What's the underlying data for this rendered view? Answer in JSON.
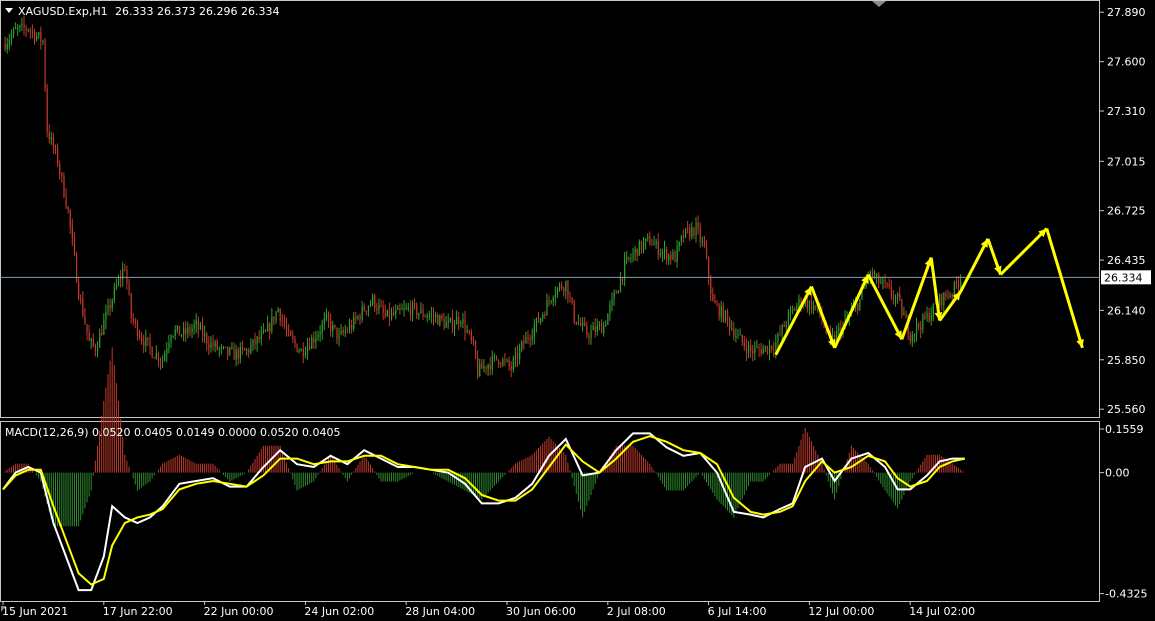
{
  "header": {
    "symbol": "XAGUSD.Exp,H1",
    "ohlc": "26.333 26.373 26.296 26.334",
    "macd_label": "MACD(12,26,9) 0.0520 0.0405 0.0149 0.0000 0.0520 0.0405"
  },
  "colors": {
    "background": "#000000",
    "bull": "#2ea02e",
    "bear": "#c0392b",
    "macd_line": "#ffffff",
    "signal_line": "#ffff00",
    "hist_pos": "#c0392b",
    "hist_neg": "#2e8b2e",
    "arrow": "#ffff00",
    "price_line": "#7f9bb3",
    "frame": "#c8c8c8"
  },
  "chart_data": [
    {
      "type": "candlestick",
      "ylim": [
        25.52,
        27.95
      ],
      "y_ticks": [
        "27.890",
        "27.600",
        "27.310",
        "27.015",
        "26.725",
        "26.435",
        "26.140",
        "25.850",
        "25.560"
      ],
      "y_tick_values": [
        27.89,
        27.6,
        27.31,
        27.015,
        26.725,
        26.435,
        26.14,
        25.85,
        25.56
      ],
      "current_price": 26.334,
      "current_price_label": "26.334",
      "x_ticks": [
        "15 Jun 2021",
        "17 Jun 22:00",
        "22 Jun 00:00",
        "24 Jun 02:00",
        "28 Jun 04:00",
        "30 Jun 06:00",
        "2 Jul 08:00",
        "6 Jul 14:00",
        "12 Jul 00:00",
        "14 Jul 02:00"
      ],
      "x_tick_bars": [
        0,
        48,
        96,
        144,
        192,
        240,
        288,
        336,
        384,
        432
      ],
      "close_path": [
        [
          0,
          27.7
        ],
        [
          6,
          27.78
        ],
        [
          12,
          27.8
        ],
        [
          16,
          27.75
        ],
        [
          19,
          27.72
        ],
        [
          21,
          27.2
        ],
        [
          26,
          27.02
        ],
        [
          31,
          26.72
        ],
        [
          36,
          26.25
        ],
        [
          41,
          25.95
        ],
        [
          44,
          25.92
        ],
        [
          49,
          26.1
        ],
        [
          54,
          26.28
        ],
        [
          58,
          26.4
        ],
        [
          61,
          26.1
        ],
        [
          66,
          25.98
        ],
        [
          71,
          25.9
        ],
        [
          76,
          25.85
        ],
        [
          80,
          26.02
        ],
        [
          86,
          26.0
        ],
        [
          92,
          26.05
        ],
        [
          98,
          25.95
        ],
        [
          104,
          25.9
        ],
        [
          110,
          25.88
        ],
        [
          116,
          25.9
        ],
        [
          120,
          25.95
        ],
        [
          125,
          26.0
        ],
        [
          131,
          26.15
        ],
        [
          136,
          25.98
        ],
        [
          142,
          25.9
        ],
        [
          148,
          25.98
        ],
        [
          154,
          26.08
        ],
        [
          160,
          25.98
        ],
        [
          166,
          26.05
        ],
        [
          172,
          26.15
        ],
        [
          176,
          26.2
        ],
        [
          182,
          26.1
        ],
        [
          188,
          26.12
        ],
        [
          194,
          26.15
        ],
        [
          200,
          26.12
        ],
        [
          206,
          26.1
        ],
        [
          212,
          26.05
        ],
        [
          218,
          26.1
        ],
        [
          224,
          25.92
        ],
        [
          226,
          25.78
        ],
        [
          230,
          25.82
        ],
        [
          236,
          25.86
        ],
        [
          242,
          25.8
        ],
        [
          248,
          25.95
        ],
        [
          256,
          26.1
        ],
        [
          262,
          26.25
        ],
        [
          268,
          26.3
        ],
        [
          272,
          26.1
        ],
        [
          278,
          26.0
        ],
        [
          286,
          26.05
        ],
        [
          292,
          26.25
        ],
        [
          296,
          26.4
        ],
        [
          302,
          26.5
        ],
        [
          308,
          26.55
        ],
        [
          314,
          26.48
        ],
        [
          320,
          26.45
        ],
        [
          324,
          26.58
        ],
        [
          330,
          26.62
        ],
        [
          334,
          26.5
        ],
        [
          338,
          26.18
        ],
        [
          344,
          26.1
        ],
        [
          350,
          25.98
        ],
        [
          356,
          25.9
        ],
        [
          364,
          25.92
        ],
        [
          368,
          25.95
        ],
        [
          374,
          26.1
        ],
        [
          380,
          26.2
        ],
        [
          388,
          26.15
        ],
        [
          394,
          25.95
        ],
        [
          400,
          26.05
        ],
        [
          408,
          26.2
        ],
        [
          412,
          26.35
        ],
        [
          418,
          26.3
        ],
        [
          426,
          26.2
        ],
        [
          432,
          26.0
        ],
        [
          440,
          26.1
        ],
        [
          446,
          26.2
        ],
        [
          452,
          26.25
        ],
        [
          456,
          26.33
        ]
      ],
      "arrow_path": [
        [
          25.88,
          368
        ],
        [
          26.28,
          385
        ],
        [
          25.92,
          396
        ],
        [
          26.35,
          412
        ],
        [
          25.97,
          428
        ],
        [
          26.45,
          442
        ],
        [
          26.08,
          446
        ],
        [
          26.25,
          456
        ],
        [
          26.56,
          469
        ],
        [
          26.35,
          475
        ],
        [
          26.62,
          497
        ],
        [
          25.92,
          514
        ]
      ]
    },
    {
      "type": "line",
      "title": "MACD(12,26,9)",
      "ylim": [
        -0.4325,
        0.1559
      ],
      "y_ticks": [
        "0.1559",
        "0.00",
        "-0.4325"
      ],
      "y_tick_values": [
        0.1559,
        0.0,
        -0.4325
      ],
      "macd_path": [
        [
          0,
          -0.06
        ],
        [
          6,
          0.0
        ],
        [
          12,
          0.02
        ],
        [
          18,
          0.0
        ],
        [
          24,
          -0.18
        ],
        [
          30,
          -0.3
        ],
        [
          36,
          -0.42
        ],
        [
          42,
          -0.42
        ],
        [
          48,
          -0.3
        ],
        [
          52,
          -0.12
        ],
        [
          58,
          -0.16
        ],
        [
          64,
          -0.18
        ],
        [
          70,
          -0.16
        ],
        [
          76,
          -0.12
        ],
        [
          84,
          -0.04
        ],
        [
          92,
          -0.03
        ],
        [
          100,
          -0.02
        ],
        [
          108,
          -0.05
        ],
        [
          116,
          -0.05
        ],
        [
          124,
          0.02
        ],
        [
          132,
          0.08
        ],
        [
          140,
          0.03
        ],
        [
          148,
          0.02
        ],
        [
          156,
          0.06
        ],
        [
          164,
          0.03
        ],
        [
          172,
          0.08
        ],
        [
          180,
          0.05
        ],
        [
          188,
          0.02
        ],
        [
          196,
          0.02
        ],
        [
          204,
          0.01
        ],
        [
          212,
          0.0
        ],
        [
          220,
          -0.04
        ],
        [
          228,
          -0.11
        ],
        [
          236,
          -0.11
        ],
        [
          244,
          -0.09
        ],
        [
          252,
          -0.04
        ],
        [
          260,
          0.06
        ],
        [
          268,
          0.12
        ],
        [
          276,
          -0.01
        ],
        [
          284,
          0.0
        ],
        [
          292,
          0.08
        ],
        [
          300,
          0.14
        ],
        [
          308,
          0.14
        ],
        [
          316,
          0.09
        ],
        [
          324,
          0.06
        ],
        [
          332,
          0.07
        ],
        [
          340,
          0.0
        ],
        [
          348,
          -0.14
        ],
        [
          356,
          -0.15
        ],
        [
          362,
          -0.16
        ],
        [
          370,
          -0.13
        ],
        [
          376,
          -0.11
        ],
        [
          382,
          0.02
        ],
        [
          390,
          0.05
        ],
        [
          396,
          -0.03
        ],
        [
          404,
          0.05
        ],
        [
          412,
          0.07
        ],
        [
          420,
          0.02
        ],
        [
          426,
          -0.06
        ],
        [
          432,
          -0.06
        ],
        [
          440,
          -0.01
        ],
        [
          446,
          0.04
        ],
        [
          452,
          0.05
        ],
        [
          458,
          0.05
        ]
      ],
      "signal_path": [
        [
          0,
          -0.06
        ],
        [
          6,
          -0.01
        ],
        [
          12,
          0.01
        ],
        [
          18,
          0.01
        ],
        [
          24,
          -0.12
        ],
        [
          30,
          -0.24
        ],
        [
          36,
          -0.36
        ],
        [
          42,
          -0.4
        ],
        [
          48,
          -0.38
        ],
        [
          52,
          -0.26
        ],
        [
          58,
          -0.18
        ],
        [
          64,
          -0.16
        ],
        [
          70,
          -0.15
        ],
        [
          76,
          -0.13
        ],
        [
          84,
          -0.06
        ],
        [
          92,
          -0.04
        ],
        [
          100,
          -0.03
        ],
        [
          108,
          -0.04
        ],
        [
          116,
          -0.05
        ],
        [
          124,
          -0.01
        ],
        [
          132,
          0.05
        ],
        [
          140,
          0.05
        ],
        [
          148,
          0.03
        ],
        [
          156,
          0.04
        ],
        [
          164,
          0.04
        ],
        [
          172,
          0.06
        ],
        [
          180,
          0.06
        ],
        [
          188,
          0.03
        ],
        [
          196,
          0.02
        ],
        [
          204,
          0.01
        ],
        [
          212,
          0.01
        ],
        [
          220,
          -0.02
        ],
        [
          228,
          -0.08
        ],
        [
          236,
          -0.1
        ],
        [
          244,
          -0.1
        ],
        [
          252,
          -0.06
        ],
        [
          260,
          0.02
        ],
        [
          268,
          0.1
        ],
        [
          276,
          0.04
        ],
        [
          284,
          0.0
        ],
        [
          292,
          0.05
        ],
        [
          300,
          0.11
        ],
        [
          308,
          0.13
        ],
        [
          316,
          0.11
        ],
        [
          324,
          0.08
        ],
        [
          332,
          0.07
        ],
        [
          340,
          0.03
        ],
        [
          348,
          -0.09
        ],
        [
          356,
          -0.14
        ],
        [
          362,
          -0.15
        ],
        [
          370,
          -0.14
        ],
        [
          376,
          -0.12
        ],
        [
          382,
          -0.03
        ],
        [
          390,
          0.04
        ],
        [
          396,
          0.0
        ],
        [
          404,
          0.02
        ],
        [
          412,
          0.06
        ],
        [
          420,
          0.04
        ],
        [
          426,
          -0.02
        ],
        [
          432,
          -0.05
        ],
        [
          440,
          -0.03
        ],
        [
          446,
          0.02
        ],
        [
          452,
          0.04
        ],
        [
          458,
          0.05
        ]
      ]
    }
  ]
}
